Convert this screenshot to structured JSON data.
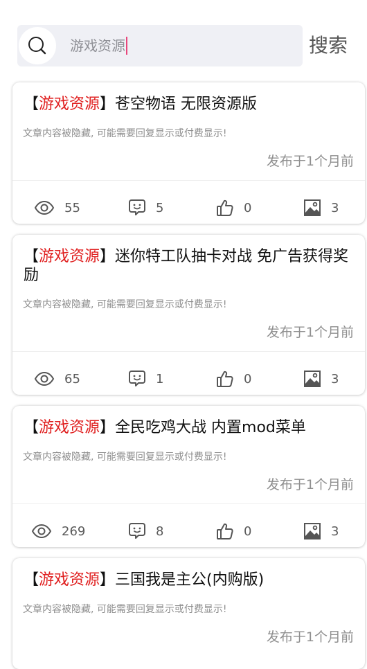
{
  "search": {
    "value": "游戏资源",
    "button_label": "搜索"
  },
  "posts": [
    {
      "tag": "游戏资源",
      "title": "苍空物语 无限资源版",
      "desc": "文章内容被隐藏, 可能需要回复显示或付费显示!",
      "time": "发布于1个月前",
      "views": "55",
      "comments": "5",
      "likes": "0",
      "images": "3"
    },
    {
      "tag": "游戏资源",
      "title": "迷你特工队抽卡对战 免广告获得奖励",
      "desc": "文章内容被隐藏, 可能需要回复显示或付费显示!",
      "time": "发布于1个月前",
      "views": "65",
      "comments": "1",
      "likes": "0",
      "images": "3"
    },
    {
      "tag": "游戏资源",
      "title": "全民吃鸡大战 内置mod菜单",
      "desc": "文章内容被隐藏, 可能需要回复显示或付费显示!",
      "time": "发布于1个月前",
      "views": "269",
      "comments": "8",
      "likes": "0",
      "images": "3"
    },
    {
      "tag": "游戏资源",
      "title": "三国我是主公(内购版)",
      "desc": "文章内容被隐藏, 可能需要回复显示或付费显示!",
      "time": "发布于1个月前"
    }
  ],
  "icons": {
    "search": "search-icon",
    "views": "eye-icon",
    "comments": "comment-icon",
    "likes": "thumbs-up-icon",
    "images": "image-icon"
  },
  "colors": {
    "tag": "#e02020",
    "cursor": "#e8467b",
    "search_bg": "#eff0f5"
  }
}
